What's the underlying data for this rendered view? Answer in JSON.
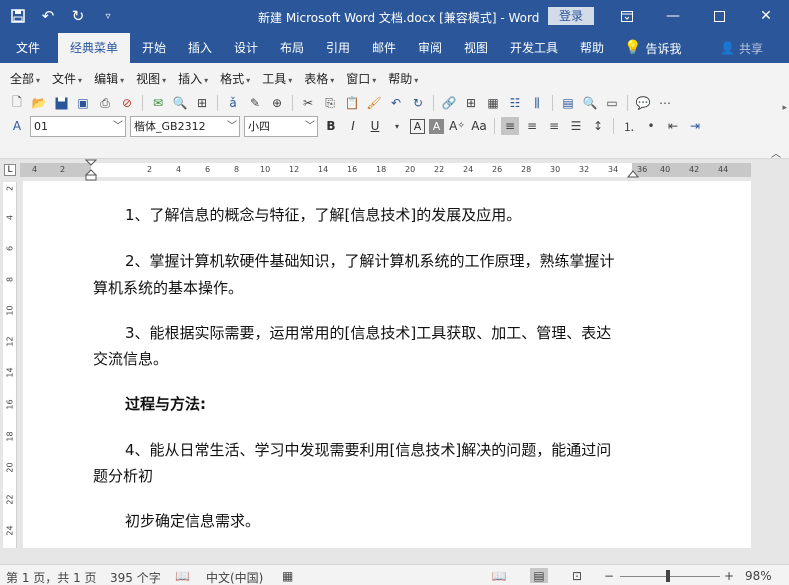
{
  "window": {
    "title": "新建 Microsoft Word 文档.docx [兼容模式] - Word",
    "login": "登录"
  },
  "tabs": [
    "文件",
    "经典菜单",
    "开始",
    "插入",
    "设计",
    "布局",
    "引用",
    "邮件",
    "审阅",
    "视图",
    "开发工具",
    "帮助"
  ],
  "active_tab": "经典菜单",
  "tell_me": "告诉我",
  "share": "共享",
  "menus": [
    "全部",
    "文件",
    "编辑",
    "视图",
    "插入",
    "格式",
    "工具",
    "表格",
    "窗口",
    "帮助"
  ],
  "font": {
    "style": "01",
    "family": "楷体_GB2312",
    "size": "小四"
  },
  "ruler": {
    "ticks": [
      "4",
      "2",
      "2",
      "4",
      "6",
      "8",
      "10",
      "12",
      "14",
      "16",
      "18",
      "20",
      "22",
      "24",
      "26",
      "28",
      "30",
      "32",
      "34",
      "36",
      "38",
      "40",
      "42",
      "44"
    ],
    "vticks": [
      "2",
      "4",
      "6",
      "8",
      "10",
      "12",
      "14",
      "16",
      "18",
      "20",
      "22",
      "24"
    ]
  },
  "document": {
    "paragraphs": [
      "1、了解信息的概念与特征，了解[信息技术]的发展及应用。",
      "2、掌握计算机软硬件基础知识，了解计算机系统的工作原理，熟练掌握计",
      "算机系统的基本操作。",
      "3、能根据实际需要，运用常用的[信息技术]工具获取、加工、管理、表达",
      "交流信息。",
      "过程与方法:",
      "4、能从日常生活、学习中发现需要利用[信息技术]解决的问题，能通过问",
      "题分析初",
      "初步确定信息需求。"
    ]
  },
  "status": {
    "page": "第 1 页，共 1 页",
    "words": "395 个字",
    "language": "中文(中国)",
    "zoom": "98%"
  }
}
